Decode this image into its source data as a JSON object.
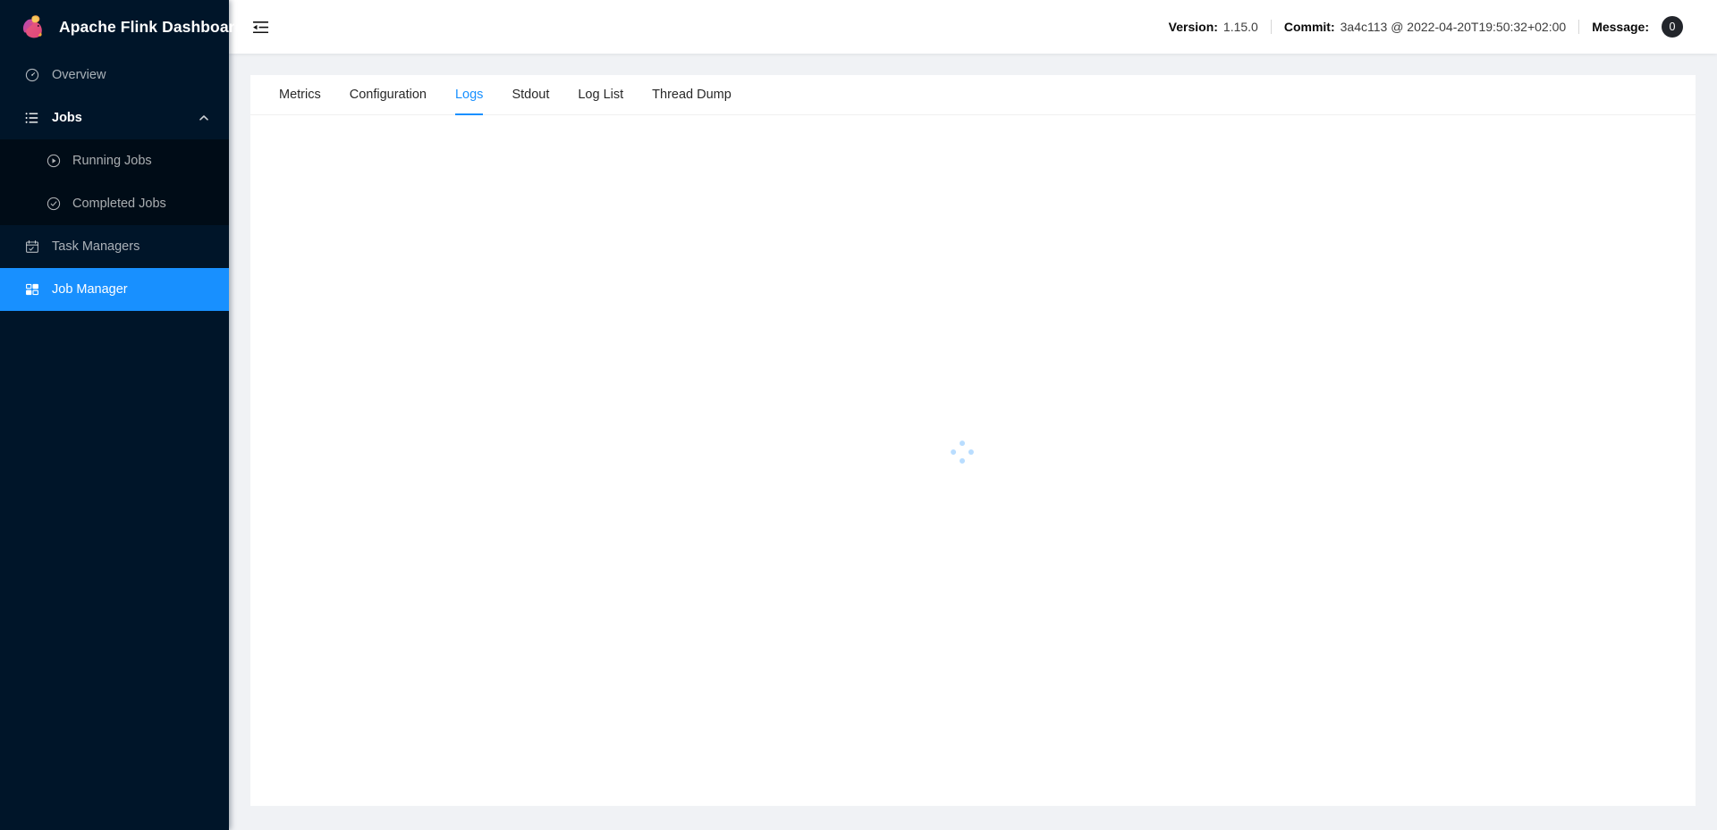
{
  "brand": {
    "title": "Apache Flink Dashboard",
    "logo_icon": "flink-squirrel-logo"
  },
  "sidebar": {
    "background_color": "#001529",
    "active_color": "#1890ff",
    "items": [
      {
        "label": "Overview",
        "icon": "dashboard-icon",
        "active": false
      },
      {
        "label": "Jobs",
        "icon": "list-icon",
        "active": false,
        "expanded": true,
        "chevron": "chevron-up-icon"
      },
      {
        "label": "Running Jobs",
        "icon": "play-circle-icon",
        "active": false,
        "child": true
      },
      {
        "label": "Completed Jobs",
        "icon": "check-circle-icon",
        "active": false,
        "child": true
      },
      {
        "label": "Task Managers",
        "icon": "schedule-icon",
        "active": false
      },
      {
        "label": "Job Manager",
        "icon": "blocks-icon",
        "active": true
      }
    ]
  },
  "topbar": {
    "fold_icon": "menu-fold-icon",
    "version_label": "Version:",
    "version_value": "1.15.0",
    "commit_label": "Commit:",
    "commit_value": "3a4c113 @ 2022-04-20T19:50:32+02:00",
    "message_label": "Message:",
    "message_count": "0"
  },
  "main": {
    "tabs": [
      {
        "label": "Metrics",
        "active": false
      },
      {
        "label": "Configuration",
        "active": false
      },
      {
        "label": "Logs",
        "active": true
      },
      {
        "label": "Stdout",
        "active": false
      },
      {
        "label": "Log List",
        "active": false
      },
      {
        "label": "Thread Dump",
        "active": false
      }
    ],
    "body_state": "loading",
    "spinner_icon": "loading-dots-icon",
    "spinner_color": "#1890ff"
  }
}
